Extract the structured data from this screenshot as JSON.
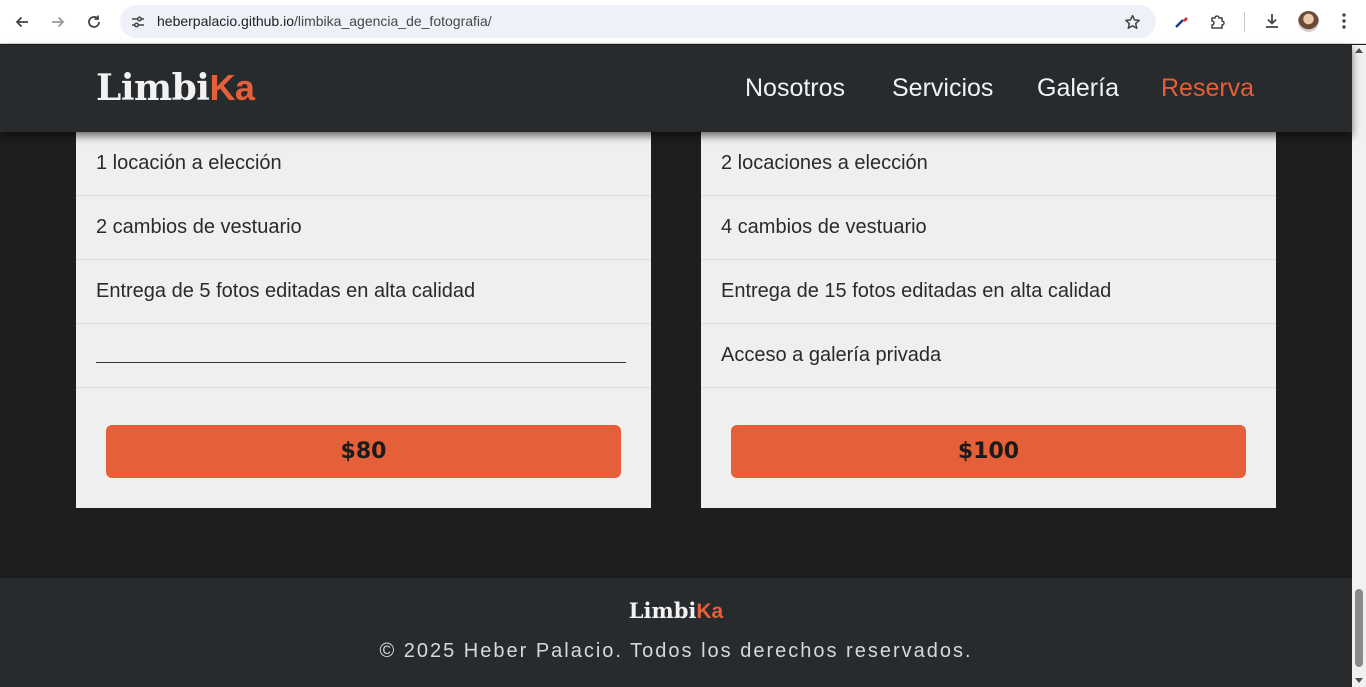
{
  "browser": {
    "url_host": "heberpalacio.github.io",
    "url_path": "/limbika_agencia_de_fotografia/"
  },
  "site": {
    "logo_main": "Limbi",
    "logo_accent": "Ka",
    "nav": [
      "Nosotros",
      "Servicios",
      "Galería",
      "Reserva"
    ],
    "active_nav": "Reserva"
  },
  "pricing": [
    {
      "features": [
        "1 locación a elección",
        "2 cambios de vestuario",
        "Entrega de 5 fotos editadas en alta calidad",
        ""
      ],
      "price": "$80"
    },
    {
      "features": [
        "2 locaciones a elección",
        "4 cambios de vestuario",
        "Entrega de 15 fotos editadas en alta calidad",
        "Acceso a galería privada"
      ],
      "price": "$100"
    }
  ],
  "footer": {
    "logo_main": "Limbi",
    "logo_accent": "Ka",
    "copyright": "© 2025 Heber Palacio. Todos los derechos reservados."
  },
  "colors": {
    "accent": "#e55f38",
    "header_bg": "#272b2e",
    "page_bg": "#1e1e1e",
    "card_bg": "#f0efef"
  }
}
